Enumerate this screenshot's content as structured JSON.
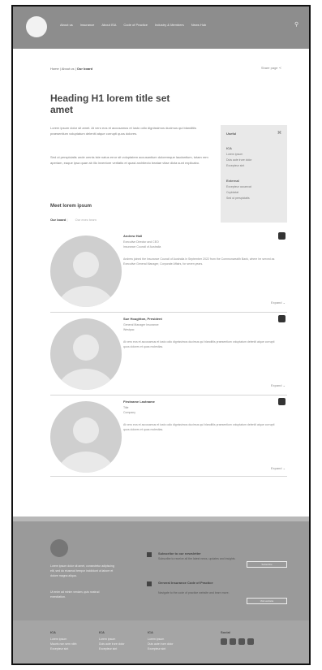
{
  "header": {
    "nav": [
      "About us",
      "Insurance",
      "About ISA",
      "Code of Practice",
      "Industry & Members",
      "News Hub"
    ]
  },
  "breadcrumb": {
    "home": "Home",
    "about": "About us",
    "current": "Our board"
  },
  "share_label": "Share page",
  "page": {
    "title": "Heading H1 lorem title set amet",
    "para1": "Lorem ipsum dolor sit amet. At vero eos et accusamus et iusto odio dignissimos ducimus qui blanditiis praesentium voluptatum deleniti atque corrupti quos dolores.",
    "para2": "Sed ut perspiciatis unde omnis iste natus error sit voluptatem accusantium doloremque laudantium, totam rem aperiam, eaque ipsa quae ab illo inventore veritatis et quasi architecto beatae vitae dicta sunt explicabo.",
    "section_title": "Meet lorem ipsum",
    "tab_active": "Our board",
    "tab_inactive": "Our exec team"
  },
  "sidebar": {
    "title": "Useful",
    "group1_head": "ICA",
    "group1": [
      "Lorem ipsum",
      "Duis aute irure dolor",
      "Excepteur sint"
    ],
    "group2_head": "External",
    "group2": [
      "Excepteur occaecat",
      "Cupidatat",
      "Sed ut perspiciatis"
    ]
  },
  "cards": [
    {
      "name": "Andrew Hall",
      "role1": "Executive Director and CEO",
      "role2": "Insurance Council of Australia",
      "bio": "Andrew joined the Insurance Council of Australia in September 2022 from the Commonwealth Bank, where he served as Executive General Manager, Corporate Affairs, for seven years.",
      "expand": "Expand"
    },
    {
      "name": "Sue Houghton, President",
      "role1": "General Manager Insurance",
      "role2": "Westpac",
      "bio": "At vero eos et accusamus et iusto odio dignissimos ducimus qui blanditiis praesentium voluptatum deleniti atque corrupti quos dolores et quas molestias.",
      "expand": "Expand"
    },
    {
      "name": "Firstname Lastname",
      "role1": "Title",
      "role2": "Company",
      "bio": "At vero eos et accusamus et iusto odio dignissimos ducimus qui blanditiis praesentium voluptatum deleniti atque corrupti quos dolores et quas molestias.",
      "expand": "Expand"
    }
  ],
  "footer": {
    "about_text": "Lorem ipsum dolor sit amet, consectetur adipiscing elit, sed do eiusmod tempor incididunt ut labore et dolore magna aliqua.",
    "about_text2": "Ut enim ad minim veniam, quis nostrud exercitation.",
    "newsletter_title": "Subscribe to our newsletter",
    "newsletter_sub": "Subscribe to receive all the latest news, updates and insights.",
    "newsletter_btn": "Subscribe",
    "code_title": "General Insurance Code of Practice",
    "code_sub": "Navigate to the code of practice website and learn more.",
    "code_btn": "Visit website",
    "col1_head": "ICA",
    "col1": [
      "Lorem ipsum",
      "Mauris non sem nibh",
      "Excepteur sint"
    ],
    "col2_head": "ICA",
    "col2": [
      "Lorem ipsum",
      "Duis aute irure dolor",
      "Excepteur sint"
    ],
    "col3_head": "ICA",
    "col3": [
      "Lorem ipsum",
      "Duis aute irure dolor",
      "Excepteur sint"
    ],
    "social_label": "Social"
  }
}
